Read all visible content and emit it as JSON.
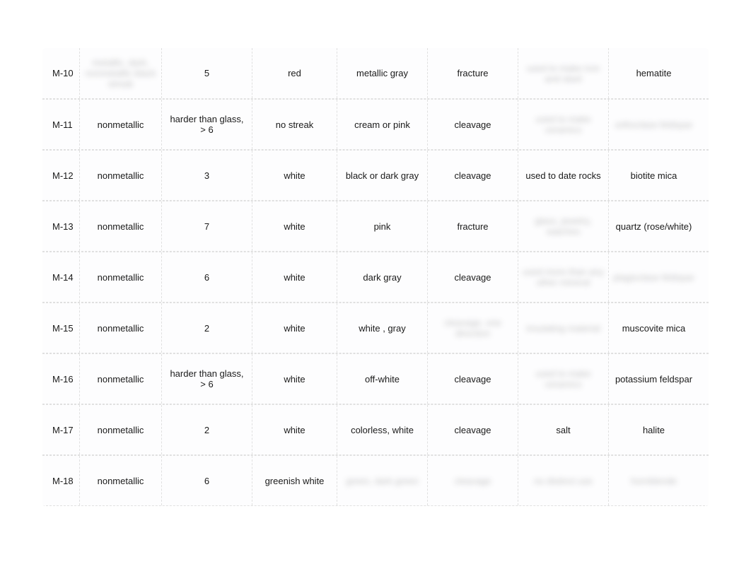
{
  "rows": [
    {
      "id": "M-10",
      "luster": "metallic, dark, nonmetallic black streak",
      "hardness": "5",
      "streak": "red",
      "color": "metallic gray",
      "break": "fracture",
      "special": "used to make iron and steel",
      "name": "hematite",
      "blurred": {
        "luster": true,
        "special": true
      }
    },
    {
      "id": "M-11",
      "luster": "nonmetallic",
      "hardness": "harder than glass, > 6",
      "streak": "no streak",
      "color": "cream or pink",
      "break": "cleavage",
      "special": "used to make ceramics",
      "name": "orthoclase feldspar",
      "blurred": {
        "special": true,
        "name": true
      }
    },
    {
      "id": "M-12",
      "luster": "nonmetallic",
      "hardness": "3",
      "streak": "white",
      "color": "black or dark gray",
      "break": "cleavage",
      "special": "used to date rocks",
      "name": "biotite mica",
      "blurred": {}
    },
    {
      "id": "M-13",
      "luster": "nonmetallic",
      "hardness": "7",
      "streak": "white",
      "color": "pink",
      "break": "fracture",
      "special": "glass, jewelry, watches",
      "name": "quartz (rose/white)",
      "blurred": {
        "special": true
      }
    },
    {
      "id": "M-14",
      "luster": "nonmetallic",
      "hardness": "6",
      "streak": "white",
      "color": "dark gray",
      "break": "cleavage",
      "special": "used more than any other mineral",
      "name": "plagioclase feldspar",
      "blurred": {
        "special": true,
        "name": true
      }
    },
    {
      "id": "M-15",
      "luster": "nonmetallic",
      "hardness": "2",
      "streak": "white",
      "color": "white , gray",
      "break": "cleavage, one direction",
      "special": "insulating material",
      "name": "muscovite mica",
      "blurred": {
        "break": true,
        "special": true
      }
    },
    {
      "id": "M-16",
      "luster": "nonmetallic",
      "hardness": "harder than glass, > 6",
      "streak": "white",
      "color": "off-white",
      "break": "cleavage",
      "special": "used to make ceramics",
      "name": "potassium feldspar",
      "blurred": {
        "special": true
      }
    },
    {
      "id": "M-17",
      "luster": "nonmetallic",
      "hardness": "2",
      "streak": "white",
      "color": "colorless, white",
      "break": "cleavage",
      "special": "salt",
      "name": "halite",
      "blurred": {}
    },
    {
      "id": "M-18",
      "luster": "nonmetallic",
      "hardness": "6",
      "streak": "greenish white",
      "color": "green, dark green",
      "break": "cleavage",
      "special": "no distinct use",
      "name": "hornblende",
      "blurred": {
        "color": true,
        "break": true,
        "special": true,
        "name": true
      }
    }
  ]
}
